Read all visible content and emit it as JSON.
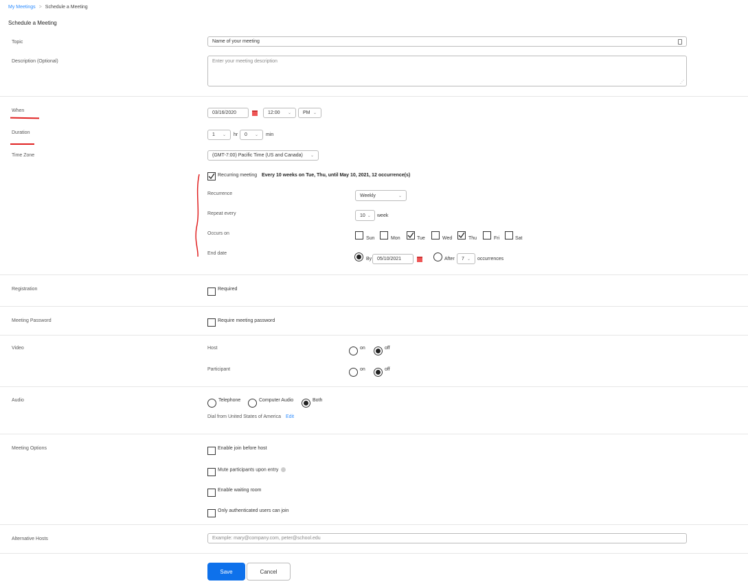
{
  "breadcrumb": {
    "link": "My Meetings",
    "separator": ">",
    "current": "Schedule a Meeting"
  },
  "page_title": "Schedule a Meeting",
  "labels": {
    "topic": "Topic",
    "description": "Description (Optional)",
    "when": "When",
    "duration": "Duration",
    "time_zone": "Time Zone",
    "registration": "Registration",
    "meeting_password": "Meeting Password",
    "video": "Video",
    "audio": "Audio",
    "meeting_options": "Meeting Options",
    "alternative_hosts": "Alternative Hosts"
  },
  "topic": {
    "value": "Name of your meeting"
  },
  "description": {
    "placeholder": "Enter your meeting description"
  },
  "when": {
    "date": "03/16/2020",
    "time": "12:00",
    "ampm": "PM"
  },
  "duration": {
    "hours": "1",
    "hr_label": "hr",
    "minutes": "0",
    "min_label": "min"
  },
  "time_zone": {
    "value": "(GMT-7:00) Pacific Time (US and Canada)"
  },
  "recurring": {
    "label": "Recurring meeting",
    "checked": true,
    "summary": "Every 10 weeks on Tue, Thu, until May 10, 2021, 12 occurrence(s)",
    "recurrence_label": "Recurrence",
    "recurrence_value": "Weekly",
    "repeat_label": "Repeat every",
    "repeat_value": "10",
    "repeat_unit": "week",
    "occurs_label": "Occurs on",
    "days": [
      {
        "label": "Sun",
        "checked": false
      },
      {
        "label": "Mon",
        "checked": false
      },
      {
        "label": "Tue",
        "checked": true
      },
      {
        "label": "Wed",
        "checked": false
      },
      {
        "label": "Thu",
        "checked": true
      },
      {
        "label": "Fri",
        "checked": false
      },
      {
        "label": "Sat",
        "checked": false
      }
    ],
    "end_label": "End date",
    "by_label": "By",
    "by_date": "05/10/2021",
    "after_label": "After",
    "after_value": "7",
    "occurrences_label": "occurrences"
  },
  "registration": {
    "label": "Required"
  },
  "password": {
    "label": "Require meeting password"
  },
  "video": {
    "host_label": "Host",
    "participant_label": "Participant",
    "on_label": "on",
    "off_label": "off"
  },
  "audio": {
    "telephone": "Telephone",
    "computer": "Computer Audio",
    "both": "Both",
    "dial_text": "Dial from United States of America",
    "edit": "Edit"
  },
  "options": {
    "join_before_host": "Enable join before host",
    "mute_on_entry": "Mute participants upon entry",
    "waiting_room": "Enable waiting room",
    "authenticated_only": "Only authenticated users can join"
  },
  "alt_hosts": {
    "placeholder": "Example: mary@company.com, peter@school.edu"
  },
  "buttons": {
    "save": "Save",
    "cancel": "Cancel"
  },
  "colors": {
    "accent": "#0e71eb",
    "link": "#2d8cff",
    "annotation": "#e02020"
  }
}
